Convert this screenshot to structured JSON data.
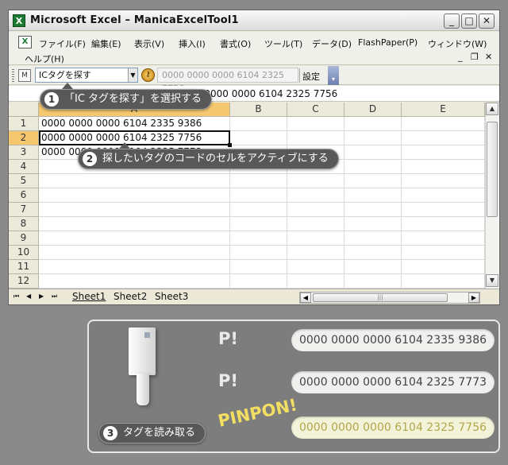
{
  "window": {
    "title": "Microsoft Excel – ManicaExcelTool1",
    "controls": {
      "minimize": "_",
      "maximize": "□",
      "close": "✕"
    }
  },
  "menu": {
    "items": [
      "ファイル(F)",
      "編集(E)",
      "表示(V)",
      "挿入(I)",
      "書式(O)",
      "ツール(T)",
      "データ(D)",
      "FlashPaper(P)",
      "ウィンドウ(W)"
    ],
    "help": "ヘルプ(H)",
    "doc_controls": [
      "_",
      "❐",
      "✕"
    ]
  },
  "toolbar": {
    "select_value": "ICタグを探す",
    "tag_field": "0000 0000 0000 6104 2325 7756",
    "settings": "設定"
  },
  "formula_bar": {
    "value": "0000 0000 0000 6104 2325 7756"
  },
  "grid": {
    "columns": [
      "A",
      "B",
      "C",
      "D",
      "E"
    ],
    "rows": [
      "1",
      "2",
      "3",
      "4",
      "5",
      "6",
      "7",
      "8",
      "9",
      "10",
      "11",
      "12"
    ],
    "cells": {
      "A1": "0000 0000 0000 6104 2335 9386",
      "A2": "0000 0000 0000 6104 2325 7756",
      "A3": "0000 0000 0000 6104 2325 7773"
    },
    "selected_column": "A",
    "selected_row": "2"
  },
  "sheets": {
    "tabs": [
      "Sheet1",
      "Sheet2",
      "Sheet3"
    ],
    "active": "Sheet1",
    "nav": [
      "⏮",
      "◀",
      "▶",
      "⏭"
    ]
  },
  "callouts": [
    {
      "num": "1",
      "text": "「IC タグを探す」を選択する"
    },
    {
      "num": "2",
      "text": "探したいタグのコードのセルをアクティブにする"
    },
    {
      "num": "3",
      "text": "タグを読み取る"
    }
  ],
  "reads": [
    {
      "label": "P!",
      "code": "0000 0000 0000 6104 2335 9386"
    },
    {
      "label": "P!",
      "code": "0000 0000 0000 6104 2325 7773"
    },
    {
      "label": "PINPON!",
      "code": "0000 0000 0000 6104 2325 7756"
    }
  ],
  "colors": {
    "selection": "#f5c76f",
    "pinpon": "#f2df62",
    "callout_bg": "#585858"
  }
}
